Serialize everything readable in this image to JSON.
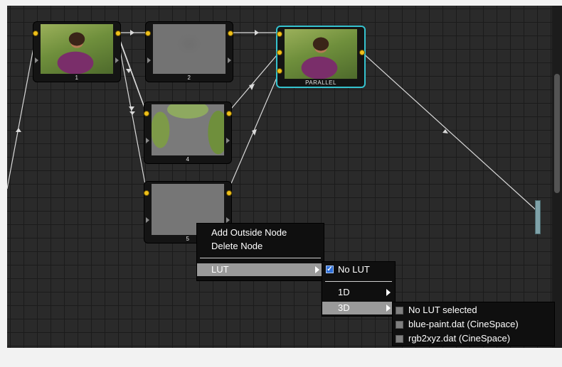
{
  "nodes": [
    {
      "id": "node-1",
      "label": "1"
    },
    {
      "id": "node-2",
      "label": "2"
    },
    {
      "id": "node-4",
      "label": "4"
    },
    {
      "id": "node-5",
      "label": "5"
    },
    {
      "id": "node-parallel",
      "label": "PARALLEL"
    }
  ],
  "context_menu": {
    "add_outside_node": "Add Outside Node",
    "delete_node": "Delete Node",
    "lut": "LUT"
  },
  "lut_menu": {
    "no_lut": "No LUT",
    "one_d": "1D",
    "three_d": "3D"
  },
  "lut_3d_menu": {
    "items": [
      "No LUT selected",
      "blue-paint.dat (CineSpace)",
      "rgb2xyz.dat (CineSpace)"
    ]
  },
  "colors": {
    "selection": "#35c3cf",
    "port": "#f0c01a",
    "checkbox_checked": "#2f6fd8"
  }
}
